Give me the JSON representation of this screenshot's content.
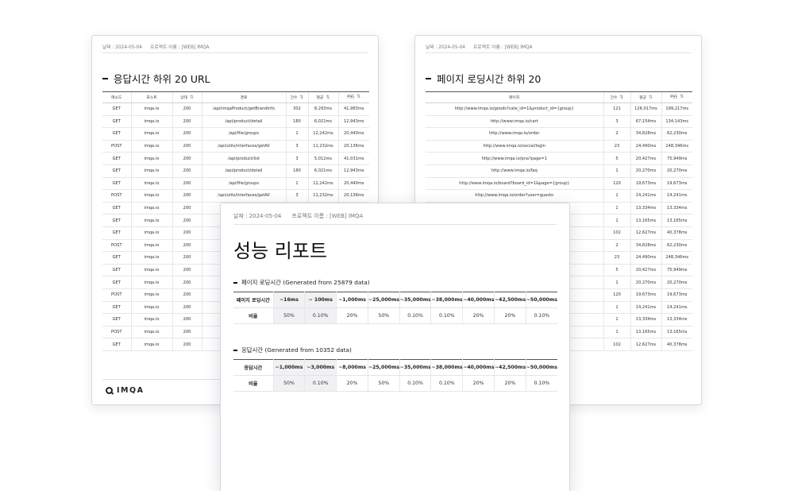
{
  "common": {
    "date_label": "날짜 : 2024-05-04",
    "project_label": "프로젝트 이름 : [WEB] IMQA",
    "logo_text": "IMQA"
  },
  "left_sheet": {
    "title": "응답시간 하위 20 URL",
    "columns": [
      "메소드",
      "호스트",
      "상태",
      "경로",
      "건수",
      "평균",
      "P95"
    ],
    "rows": [
      [
        "GET",
        "imqa.io",
        "200",
        "/api/imqaProduct/getBrandInfo",
        "302",
        "8,293ms",
        "41,983ms"
      ],
      [
        "GET",
        "imqa.io",
        "200",
        "/api/product/detail",
        "180",
        "6,021ms",
        "12,943ms"
      ],
      [
        "GET",
        "imqa.io",
        "200",
        "/api/file/groups",
        "1",
        "12,242ms",
        "20,440ms"
      ],
      [
        "POST",
        "imqa.io",
        "200",
        "/api/utils/interfaces/getAll",
        "3",
        "11,232ms",
        "20,136ms"
      ],
      [
        "GET",
        "imqa.io",
        "200",
        "/api/product/list",
        "3",
        "5,012ms",
        "41,031ms"
      ],
      [
        "GET",
        "imqa.io",
        "200",
        "/api/product/detail",
        "180",
        "6,021ms",
        "12,943ms"
      ],
      [
        "GET",
        "imqa.io",
        "200",
        "/api/file/groups",
        "1",
        "12,242ms",
        "20,440ms"
      ],
      [
        "POST",
        "imqa.io",
        "200",
        "/api/utils/interfaces/getAll",
        "3",
        "11,232ms",
        "20,136ms"
      ],
      [
        "GET",
        "imqa.io",
        "200",
        "",
        "",
        "",
        ""
      ],
      [
        "GET",
        "imqa.io",
        "200",
        "",
        "",
        "",
        ""
      ],
      [
        "GET",
        "imqa.io",
        "200",
        "",
        "",
        "",
        ""
      ],
      [
        "POST",
        "imqa.io",
        "200",
        "",
        "",
        "",
        ""
      ],
      [
        "GET",
        "imqa.io",
        "200",
        "",
        "",
        "",
        ""
      ],
      [
        "GET",
        "imqa.io",
        "200",
        "",
        "",
        "",
        ""
      ],
      [
        "GET",
        "imqa.io",
        "200",
        "",
        "",
        "",
        ""
      ],
      [
        "POST",
        "imqa.io",
        "200",
        "",
        "",
        "",
        ""
      ],
      [
        "GET",
        "imqa.io",
        "200",
        "",
        "",
        "",
        ""
      ],
      [
        "GET",
        "imqa.io",
        "200",
        "",
        "",
        "",
        ""
      ],
      [
        "POST",
        "imqa.io",
        "200",
        "",
        "",
        "",
        ""
      ],
      [
        "GET",
        "imqa.io",
        "200",
        "",
        "",
        "",
        ""
      ]
    ]
  },
  "right_sheet": {
    "title": "페이지 로딩시간 하위 20",
    "columns": [
      "페이지",
      "건수",
      "평균",
      "P95"
    ],
    "rows": [
      [
        "http://www.imqa.io/goods?cate_id=1&product_id={group}",
        "121",
        "126,017ms",
        "199,217ms"
      ],
      [
        "http://www.imqa.io/cart",
        "3",
        "67,154ms",
        "134,143ms"
      ],
      [
        "http://www.imqa.io/order",
        "2",
        "34,828ms",
        "62,230ms"
      ],
      [
        "http://www.imqa.io/social/login",
        "23",
        "24,490ms",
        "248,346ms"
      ],
      [
        "http://www.imqa.io/qna?page=1",
        "5",
        "20,427ms",
        "75,949ms"
      ],
      [
        "http://www.imqa.io/faq",
        "1",
        "20,270ms",
        "20,270ms"
      ],
      [
        "http://www.imqa.io/board?board_id=1&page={group}",
        "120",
        "19,673ms",
        "19,673ms"
      ],
      [
        "http://www.imqa.io/order?user=guesto",
        "1",
        "14,241ms",
        "14,241ms"
      ],
      [
        "",
        "1",
        "13,334ms",
        "13,334ms"
      ],
      [
        "",
        "1",
        "13,165ms",
        "13,165ms"
      ],
      [
        "",
        "102",
        "12,627ms",
        "40,378ms"
      ],
      [
        "",
        "2",
        "34,828ms",
        "62,230ms"
      ],
      [
        "",
        "23",
        "24,490ms",
        "248,346ms"
      ],
      [
        "",
        "5",
        "20,427ms",
        "75,949ms"
      ],
      [
        "",
        "1",
        "20,270ms",
        "20,270ms"
      ],
      [
        "",
        "120",
        "19,673ms",
        "19,673ms"
      ],
      [
        "",
        "1",
        "14,241ms",
        "14,241ms"
      ],
      [
        "",
        "1",
        "13,334ms",
        "13,334ms"
      ],
      [
        "",
        "1",
        "13,165ms",
        "13,165ms"
      ],
      [
        "",
        "102",
        "12,627ms",
        "40,378ms"
      ]
    ]
  },
  "front_sheet": {
    "title": "성능 리포트",
    "page_section": {
      "subtitle": "페이지 로딩시간  (Generated from 25879 data)",
      "row_header": "페이지 로딩시간",
      "ranges": [
        "~16ms",
        "~ 100ms",
        "~1,000ms",
        "~25,000ms",
        "~35,000ms",
        "~38,000ms",
        "~40,000ms",
        "~42,500ms",
        "~50,000ms"
      ],
      "ratio_label": "비율",
      "ratios": [
        "50%",
        "0.10%",
        "20%",
        "50%",
        "0.10%",
        "0.10%",
        "20%",
        "20%",
        "0.10%"
      ]
    },
    "response_section": {
      "subtitle": "응답시간 (Generated from 10352 data)",
      "row_header": "응답시간",
      "ranges": [
        "~1,000ms",
        "~3,000ms",
        "~8,000ms",
        "~25,000ms",
        "~35,000ms",
        "~38,000ms",
        "~40,000ms",
        "~42,500ms",
        "~50,000ms"
      ],
      "ratio_label": "비율",
      "ratios": [
        "50%",
        "0.10%",
        "20%",
        "50%",
        "0.10%",
        "0.10%",
        "20%",
        "20%",
        "0.10%"
      ]
    }
  }
}
